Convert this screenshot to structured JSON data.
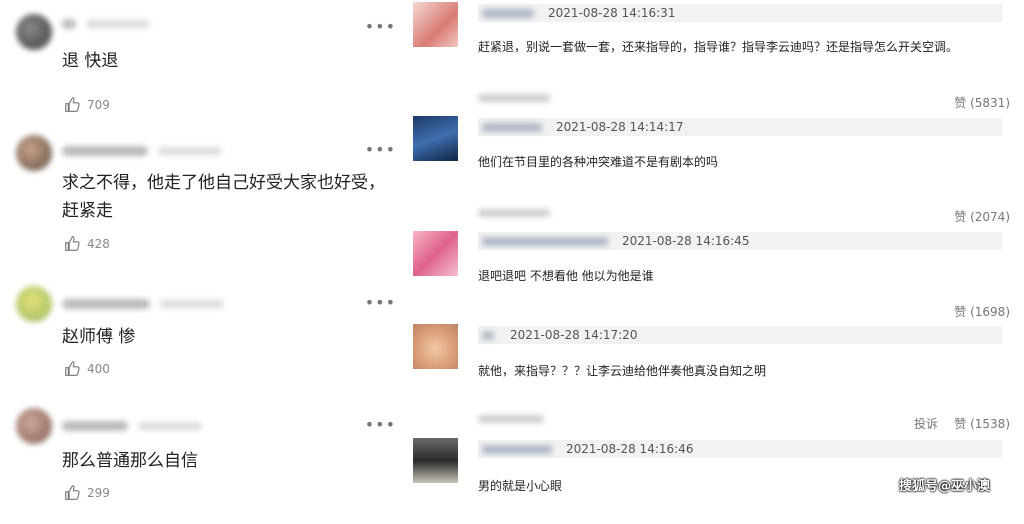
{
  "left_comments": [
    {
      "text": "退 快退",
      "likes": "709"
    },
    {
      "text": "求之不得，他走了他自己好受大家也好受，\n赶紧走",
      "likes": "428"
    },
    {
      "text": "赵师傅 惨",
      "likes": "400"
    },
    {
      "text": "那么普通那么自信",
      "likes": "299"
    }
  ],
  "right_comments": [
    {
      "time": "2021-08-28 14:16:31",
      "text": "赶紧退，别说一套做一套，还来指导的，指导谁？指导李云迪吗？还是指导怎么开关空调。",
      "likes": "赞 (5831)"
    },
    {
      "time": "2021-08-28 14:14:17",
      "text": "他们在节目里的各种冲突难道不是有剧本的吗",
      "likes": "赞 (2074)"
    },
    {
      "time": "2021-08-28 14:16:45",
      "text": "退吧退吧 不想看他 他以为他是谁",
      "likes": "赞 (1698)"
    },
    {
      "time": "2021-08-28 14:17:20",
      "text": "就他，来指导？？？让李云迪给他伴奏他真没自知之明",
      "likes": "赞 (1538)",
      "report": "投诉"
    },
    {
      "time": "2021-08-28 14:16:46",
      "text": "男的就是小心眼"
    }
  ],
  "watermark": "搜狐号@巫小澳",
  "icons": {
    "more": "more-dots-icon",
    "like": "thumb-up-icon"
  }
}
